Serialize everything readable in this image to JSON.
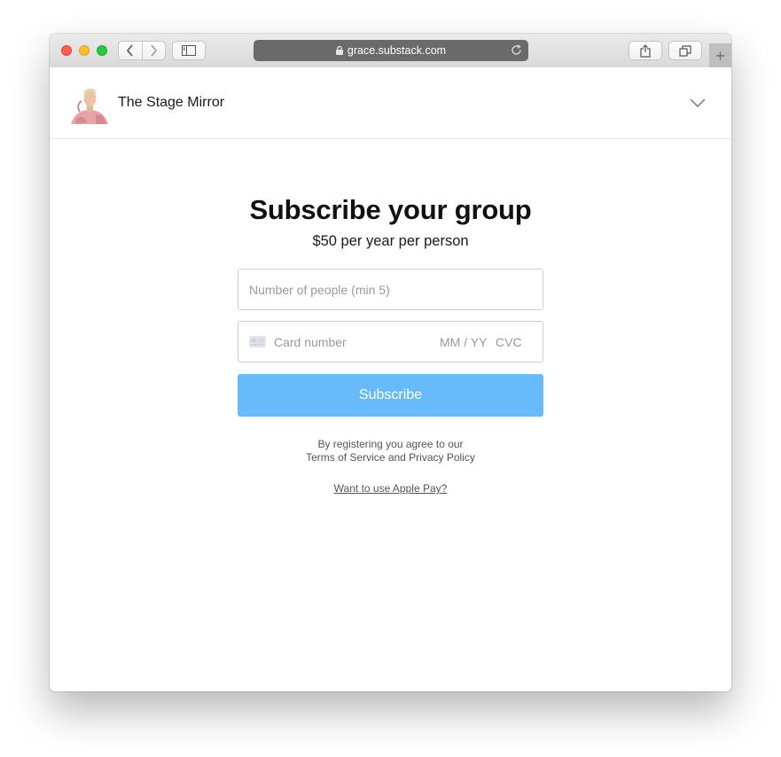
{
  "browser": {
    "url": "grace.substack.com",
    "new_tab_symbol": "+"
  },
  "header": {
    "publication_name": "The Stage Mirror",
    "avatar_icon": "author-photo",
    "menu_icon": "chevron-down-icon"
  },
  "form": {
    "title": "Subscribe your group",
    "price": "$50 per year per person",
    "people_placeholder": "Number of people (min 5)",
    "card_placeholder": "Card number",
    "expiry_placeholder": "MM / YY",
    "cvc_placeholder": "CVC",
    "subscribe_label": "Subscribe",
    "legal_line1": "By registering you agree to our",
    "legal_line2": "Terms of Service and Privacy Policy",
    "apple_pay_link": "Want to use Apple Pay?"
  },
  "colors": {
    "button_bg": "#68bbfa",
    "address_bar": "#6a6a6a"
  }
}
